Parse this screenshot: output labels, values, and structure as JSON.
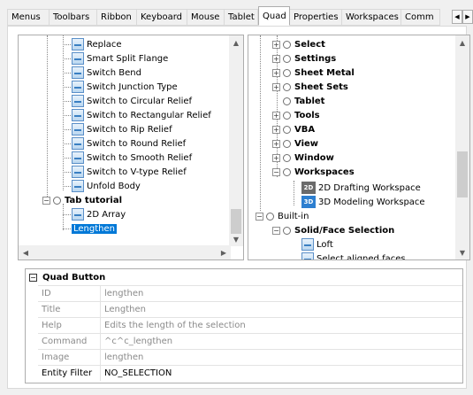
{
  "tabs": [
    {
      "label": "Menus",
      "active": false
    },
    {
      "label": "Toolbars",
      "active": false
    },
    {
      "label": "Ribbon",
      "active": false
    },
    {
      "label": "Keyboard",
      "active": false
    },
    {
      "label": "Mouse",
      "active": false
    },
    {
      "label": "Tablet",
      "active": false
    },
    {
      "label": "Quad",
      "active": true
    },
    {
      "label": "Properties",
      "active": false
    },
    {
      "label": "Workspaces",
      "active": false
    },
    {
      "label": "Comm",
      "active": false
    }
  ],
  "left_tree": {
    "items": [
      {
        "label": "Replace",
        "icon": "replace-icon"
      },
      {
        "label": "Smart Split Flange",
        "icon": "split-flange-icon"
      },
      {
        "label": "Switch Bend",
        "icon": "switch-bend-icon"
      },
      {
        "label": "Switch Junction Type",
        "icon": "junction-icon"
      },
      {
        "label": "Switch to Circular Relief",
        "icon": "relief-icon"
      },
      {
        "label": "Switch to Rectangular Relief",
        "icon": "relief-icon"
      },
      {
        "label": "Switch to Rip Relief",
        "icon": "relief-icon"
      },
      {
        "label": "Switch to Round Relief",
        "icon": "relief-icon"
      },
      {
        "label": "Switch to Smooth Relief",
        "icon": "relief-icon"
      },
      {
        "label": "Switch to V-type Relief",
        "icon": "relief-icon"
      },
      {
        "label": "Unfold Body",
        "icon": "unfold-icon"
      }
    ],
    "group": {
      "label": "Tab tutorial"
    },
    "children": [
      {
        "label": "2D Array",
        "icon": "array-icon"
      },
      {
        "label": "Lengthen",
        "selected": true
      }
    ]
  },
  "right_tree": {
    "items": [
      {
        "label": "Select",
        "bold": true
      },
      {
        "label": "Settings",
        "bold": true
      },
      {
        "label": "Sheet Metal",
        "bold": true
      },
      {
        "label": "Sheet Sets",
        "bold": true
      },
      {
        "label": "Tablet",
        "bold": true
      },
      {
        "label": "Tools",
        "bold": true
      },
      {
        "label": "VBA",
        "bold": true
      },
      {
        "label": "View",
        "bold": true
      },
      {
        "label": "Window",
        "bold": true
      },
      {
        "label": "Workspaces",
        "bold": true
      }
    ],
    "workspaces": [
      {
        "label": "2D Drafting Workspace",
        "badge": "2D"
      },
      {
        "label": "3D Modeling Workspace",
        "badge": "3D"
      }
    ],
    "builtin": {
      "label": "Built-in"
    },
    "solid": {
      "label": "Solid/Face Selection"
    },
    "solid_children": [
      {
        "label": "Loft"
      },
      {
        "label": "Select aligned faces"
      }
    ]
  },
  "properties": {
    "header": "Quad Button",
    "rows": [
      {
        "key": "ID",
        "value": "lengthen",
        "dark": false
      },
      {
        "key": "Title",
        "value": "Lengthen",
        "dark": false
      },
      {
        "key": "Help",
        "value": "Edits the length of the selection",
        "dark": false
      },
      {
        "key": "Command",
        "value": "^c^c_lengthen",
        "dark": false
      },
      {
        "key": "Image",
        "value": "lengthen",
        "dark": false
      },
      {
        "key": "Entity Filter",
        "value": "NO_SELECTION",
        "dark": true
      }
    ]
  },
  "colors": {
    "selection": "#0078d7",
    "accent_blue": "#3a7fc2"
  }
}
